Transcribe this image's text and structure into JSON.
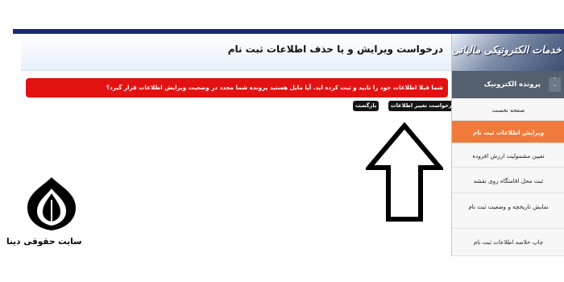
{
  "page": {
    "title": "درخواست ویرایش و یا حذف اطلاعات ثبت نام"
  },
  "alert": {
    "message": "شما قبلا اطلاعات خود را تایید و ثبت کرده اید. آیا مایل هستید پرونده شما مجدد در وضعیت ویرایش اطلاعات قرار گیرد؟"
  },
  "buttons": {
    "request_change": "درخواست تغییر اطلاعات",
    "back": "بازگشت"
  },
  "sidebar": {
    "banner": "خدمات الکترونیکی مالیاتی",
    "section": "پرونده الکترونیک",
    "toggle_icon": "collapse-toggle-icon",
    "items": [
      {
        "label": "صفحه نخست",
        "active": false
      },
      {
        "label": "ویرایش اطلاعات ثبت نام",
        "active": true
      },
      {
        "label": "تعیین مشمولیت ارزش افزوده",
        "active": false
      },
      {
        "label": "ثبت محل اقامتگاه روی نقشه",
        "active": false
      },
      {
        "label": "نمایش تاریخچه و وضعیت ثبت نام",
        "active": false
      },
      {
        "label": "چاپ خلاصه اطلاعات ثبت نام",
        "active": false
      }
    ]
  },
  "watermark": {
    "site_name": "سایت حقوقی دینا",
    "icon": "pen-nib-logo-icon"
  },
  "annotation": {
    "icon": "up-arrow-pointer-icon"
  },
  "colors": {
    "alert_bg": "#e31212",
    "active_item": "#f07a3b",
    "section_bg": "#55606e",
    "topbar": "#1b2a72"
  }
}
